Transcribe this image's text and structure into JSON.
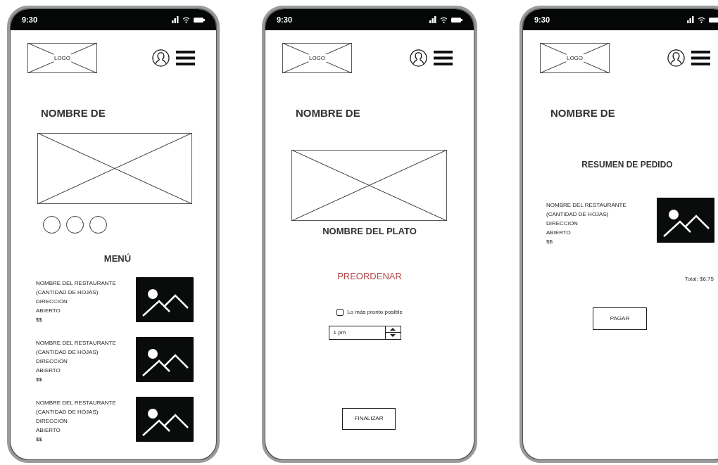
{
  "phones": [
    {
      "kind": "menu",
      "status_time": "9:30",
      "logo": "LOGO",
      "heading": "NOMBRE DE",
      "menu_title": "MENÚ",
      "restaurants": [
        {
          "name": "NOMBRE DEL RESTAURANTE",
          "quantity": "(CANTIDAD DE HOJAS)",
          "address": "DIRECCION",
          "status": "ABIERTO",
          "price": "$$"
        },
        {
          "name": "NOMBRE DEL RESTAURANTE",
          "quantity": "(CANTIDAD DE HOJAS)",
          "address": "DIRECCION",
          "status": "ABIERTO",
          "price": "$$"
        },
        {
          "name": "NOMBRE DEL RESTAURANTE",
          "quantity": "(CANTIDAD DE HOJAS)",
          "address": "DIRECCION",
          "status": "ABIERTO",
          "price": "$$"
        }
      ]
    },
    {
      "kind": "dish",
      "status_time": "9:30",
      "logo": "LOGO",
      "heading": "NOMBRE DE",
      "dish_name": "NOMBRE DEL PLATO",
      "preorder": "PREORDENAR",
      "asap": {
        "label": "Lo más pronto posible",
        "checked": false
      },
      "time_field": {
        "value": "1 pm"
      },
      "finish_button": "FINALIZAR"
    },
    {
      "kind": "summary",
      "status_time": "9:30",
      "logo": "LOGO",
      "heading": "NOMBRE DE",
      "summary_title": "RESUMEN DE PEDIDO",
      "restaurant": {
        "name": "NOMBRE DEL RESTAURANTE",
        "quantity": "(CANTIDAD DE HOJAS)",
        "address": "DIRECCION",
        "status": "ABIERTO",
        "price": "$$"
      },
      "total": "Total: $6.75",
      "pay_button": "PAGAR"
    }
  ]
}
